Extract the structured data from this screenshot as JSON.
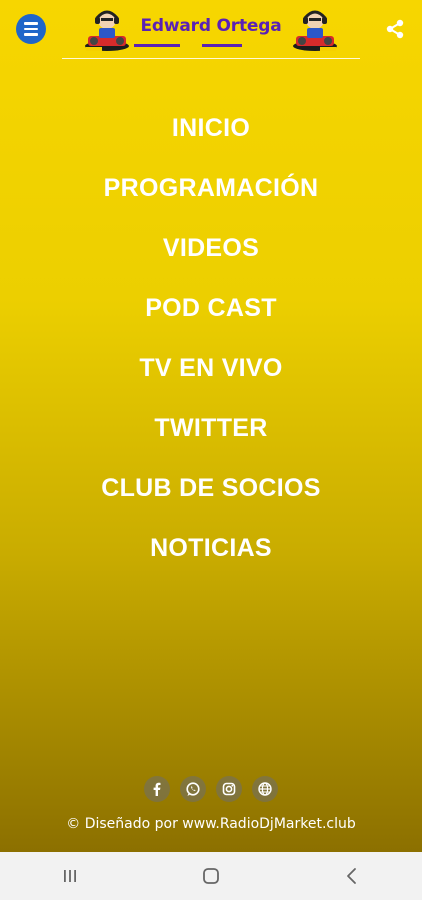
{
  "header": {
    "logo_title": "Edward Ortega"
  },
  "menu": {
    "items": [
      {
        "label": "INICIO"
      },
      {
        "label": "PROGRAMACIÓN"
      },
      {
        "label": "VIDEOS"
      },
      {
        "label": "POD CAST"
      },
      {
        "label": "TV EN VIVO"
      },
      {
        "label": "TWITTER"
      },
      {
        "label": "CLUB DE SOCIOS"
      },
      {
        "label": "NOTICIAS"
      }
    ]
  },
  "social": [
    {
      "icon": "facebook-icon"
    },
    {
      "icon": "whatsapp-icon"
    },
    {
      "icon": "instagram-icon"
    },
    {
      "icon": "globe-icon"
    }
  ],
  "footer": {
    "credit_prefix": "© Diseñado por",
    "credit_link": "www.RadioDjMarket.club"
  },
  "colors": {
    "background_top": "#f7d600",
    "background_bottom": "#8c7000",
    "menu_button": "#1f66c9",
    "logo_text": "#5a21b5",
    "nav_bar": "#f2f2f2"
  },
  "system_nav": {
    "icons": [
      "recent-apps-icon",
      "home-icon",
      "back-icon"
    ]
  }
}
